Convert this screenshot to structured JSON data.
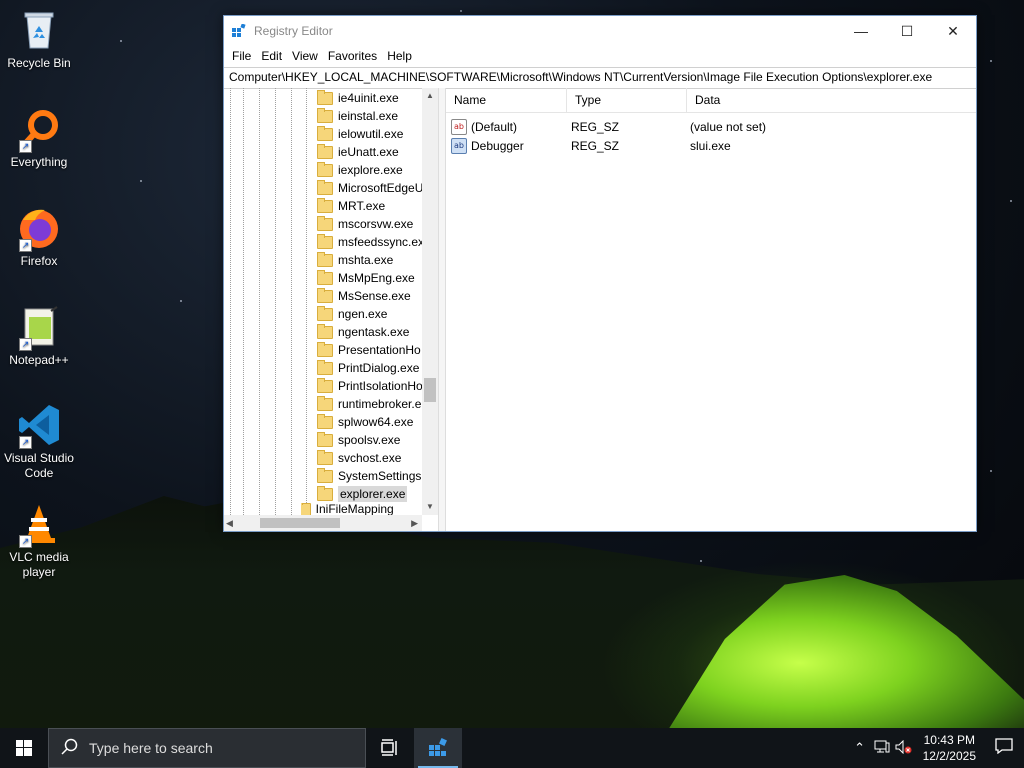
{
  "desktop": {
    "icons": [
      {
        "label": "Recycle Bin",
        "icon": "recycle-bin-icon"
      },
      {
        "label": "Everything",
        "icon": "everything-search-icon"
      },
      {
        "label": "Firefox",
        "icon": "firefox-icon"
      },
      {
        "label": "Notepad++",
        "icon": "notepad-plus-plus-icon"
      },
      {
        "label": "Visual Studio Code",
        "icon": "vscode-icon"
      },
      {
        "label": "VLC media player",
        "icon": "vlc-icon"
      }
    ]
  },
  "window": {
    "title": "Registry Editor",
    "menu": [
      "File",
      "Edit",
      "View",
      "Favorites",
      "Help"
    ],
    "address": "Computer\\HKEY_LOCAL_MACHINE\\SOFTWARE\\Microsoft\\Windows NT\\CurrentVersion\\Image File Execution Options\\explorer.exe",
    "tree": [
      "ie4uinit.exe",
      "ieinstal.exe",
      "ielowutil.exe",
      "ieUnatt.exe",
      "iexplore.exe",
      "MicrosoftEdgeU",
      "MRT.exe",
      "mscorsvw.exe",
      "msfeedssync.ex",
      "mshta.exe",
      "MsMpEng.exe",
      "MsSense.exe",
      "ngen.exe",
      "ngentask.exe",
      "PresentationHo",
      "PrintDialog.exe",
      "PrintIsolationHo",
      "runtimebroker.e",
      "splwow64.exe",
      "spoolsv.exe",
      "svchost.exe",
      "SystemSettings.",
      "explorer.exe"
    ],
    "tree_selected": "explorer.exe",
    "tree_next_partial": "IniFileMapping",
    "columns": [
      "Name",
      "Type",
      "Data"
    ],
    "values": [
      {
        "name": "(Default)",
        "type": "REG_SZ",
        "data": "(value not set)",
        "icon": "string-value-icon"
      },
      {
        "name": "Debugger",
        "type": "REG_SZ",
        "data": "slui.exe",
        "icon": "string-value-icon"
      }
    ]
  },
  "taskbar": {
    "search_placeholder": "Type here to search",
    "time": "10:43 PM",
    "date": "12/2/2025"
  }
}
